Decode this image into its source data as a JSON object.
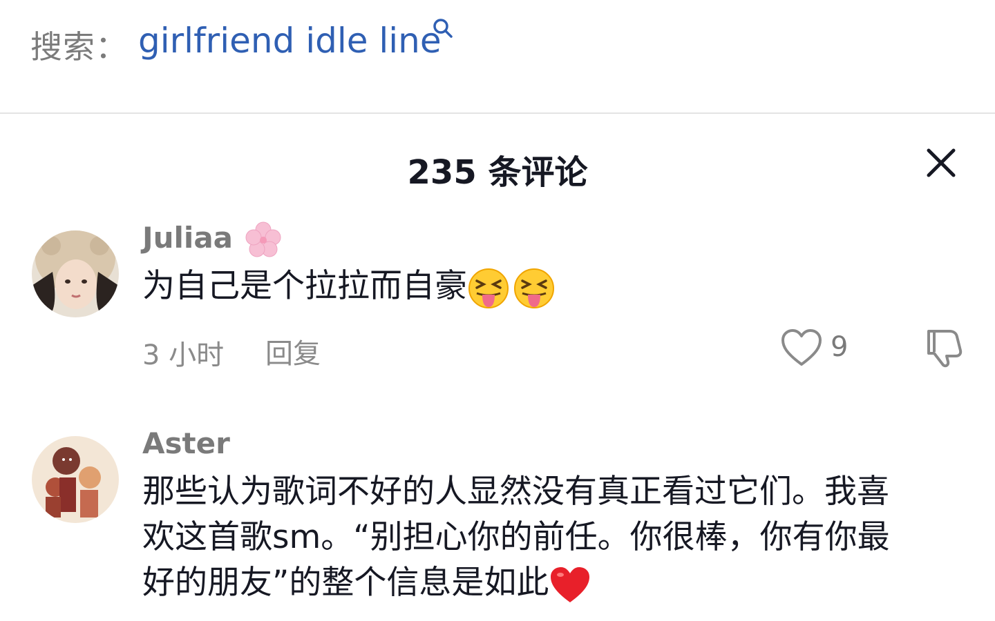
{
  "search": {
    "prefix": "搜索：",
    "query": "girlfriend idle line"
  },
  "sheet": {
    "title": "235 条评论"
  },
  "comments": [
    {
      "username": "Juliaa",
      "text": "为自己是个拉拉而自豪",
      "time": "3 小时",
      "reply_label": "回复",
      "likes": "9"
    },
    {
      "username": "Aster",
      "line1": "那些认为歌词不好的人显然没有真正看过它们。我喜",
      "line2": "欢这首歌sm。“别担心你的前任。你很棒，你有你最",
      "line3": "好的朋友”的整个信息是如此"
    }
  ],
  "icons": {
    "search": "search-icon",
    "close": "close-icon",
    "like": "heart-icon",
    "dislike": "thumbs-down-icon",
    "flower": "cherry-blossom-icon",
    "squint_tongue": "squinting-face-with-tongue-emoji",
    "heart_emoji": "red-heart-emoji"
  },
  "colors": {
    "link": "#2f5fb3",
    "muted": "#8a8a8a",
    "text": "#161823"
  }
}
